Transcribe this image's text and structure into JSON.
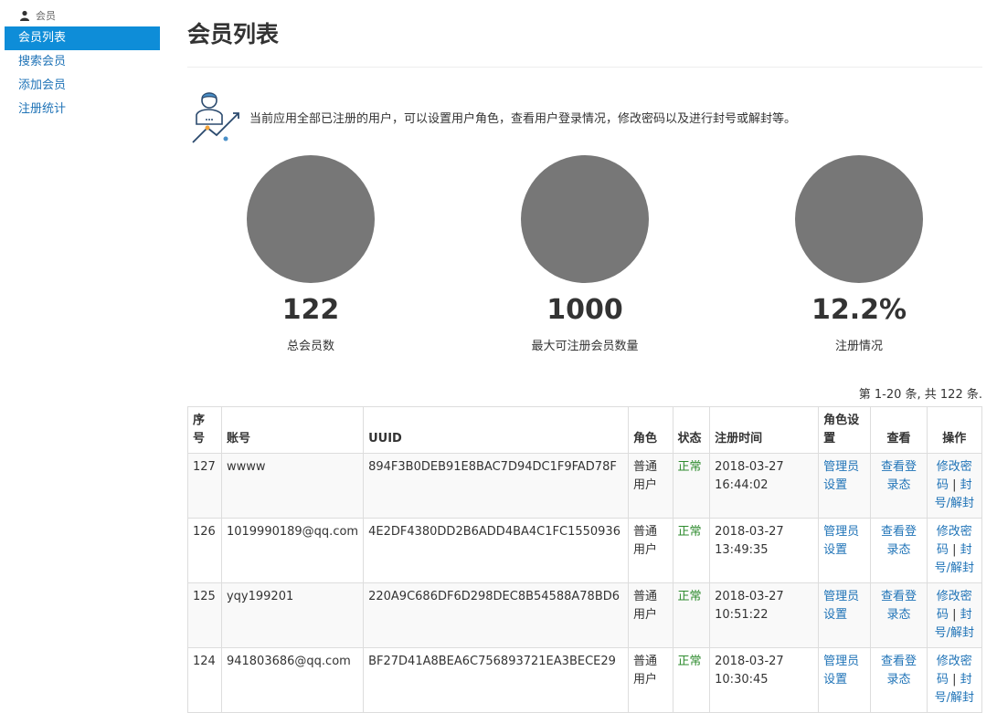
{
  "sidebar": {
    "section": "会员",
    "items": [
      {
        "label": "会员列表",
        "active": true
      },
      {
        "label": "搜索会员"
      },
      {
        "label": "添加会员"
      },
      {
        "label": "注册统计"
      }
    ]
  },
  "page": {
    "title": "会员列表",
    "intro": "当前应用全部已注册的用户，可以设置用户角色，查看用户登录情况，修改密码以及进行封号或解封等。"
  },
  "stats": [
    {
      "value": "122",
      "label": "总会员数"
    },
    {
      "value": "1000",
      "label": "最大可注册会员数量"
    },
    {
      "value": "12.2%",
      "label": "注册情况"
    }
  ],
  "summary": "第 1-20 条, 共 122 条.",
  "table": {
    "headers": [
      "序号",
      "账号",
      "UUID",
      "角色",
      "状态",
      "注册时间",
      "角色设置",
      "查看",
      "操作"
    ],
    "rows": [
      {
        "id": "127",
        "account": "wwww",
        "uuid": "894F3B0DEB91E8BAC7D94DC1F9FAD78F",
        "role": "普通用户",
        "status": "正常",
        "time": "2018-03-27 16:44:02"
      },
      {
        "id": "126",
        "account": "1019990189@qq.com",
        "uuid": "4E2DF4380DD2B6ADD4BA4C1FC1550936",
        "role": "普通用户",
        "status": "正常",
        "time": "2018-03-27 13:49:35"
      },
      {
        "id": "125",
        "account": "yqy199201",
        "uuid": "220A9C686DF6D298DEC8B54588A78BD6",
        "role": "普通用户",
        "status": "正常",
        "time": "2018-03-27 10:51:22"
      },
      {
        "id": "124",
        "account": "941803686@qq.com",
        "uuid": "BF27D41A8BEA6C756893721EA3BECE29",
        "role": "普通用户",
        "status": "正常",
        "time": "2018-03-27 10:30:45"
      }
    ],
    "actions": {
      "set_admin": "管理员设置",
      "view_login": "查看登录态",
      "change_pwd": "修改密码",
      "separator": "|",
      "ban": "封号/解封"
    }
  },
  "colors": {
    "accent": "#0e8dd8",
    "link": "#1f73b7",
    "status_ok": "#2e8b2e",
    "circle": "#777777"
  },
  "icons": {
    "sidebar_section": "user-icon",
    "intro": "user-growth-illustration-icon"
  }
}
